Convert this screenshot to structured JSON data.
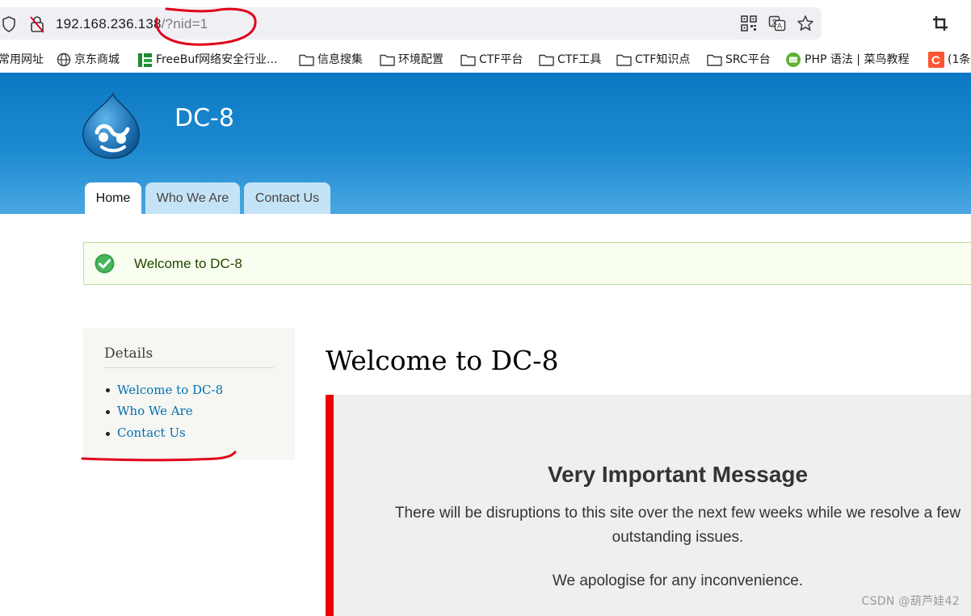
{
  "browser": {
    "url_host": "192.168.236.138",
    "url_path": "/?nid=1",
    "bookmarks": [
      {
        "label": "常用网址",
        "icon": "none"
      },
      {
        "label": "京东商城",
        "icon": "globe-icon"
      },
      {
        "label": "FreeBuf网络安全行业...",
        "icon": "freebuf-icon"
      },
      {
        "label": "信息搜集",
        "icon": "folder-icon"
      },
      {
        "label": "环境配置",
        "icon": "folder-icon"
      },
      {
        "label": "CTF平台",
        "icon": "folder-icon"
      },
      {
        "label": "CTF工具",
        "icon": "folder-icon"
      },
      {
        "label": "CTF知识点",
        "icon": "folder-icon"
      },
      {
        "label": "SRC平台",
        "icon": "folder-icon"
      },
      {
        "label": "PHP 语法 | 菜鸟教程",
        "icon": "runoob-icon"
      },
      {
        "label": "(1条",
        "icon": "csdn-icon"
      }
    ]
  },
  "site": {
    "name": "DC-8",
    "tabs": [
      {
        "label": "Home",
        "active": true
      },
      {
        "label": "Who We Are",
        "active": false
      },
      {
        "label": "Contact Us",
        "active": false
      }
    ],
    "status_message": "Welcome to DC-8"
  },
  "sidebar": {
    "title": "Details",
    "links": [
      "Welcome to DC-8",
      "Who We Are",
      "Contact Us"
    ]
  },
  "main": {
    "title": "Welcome to DC-8",
    "message_heading": "Very Important Message",
    "paragraph1_line1": "There will be disruptions to this site over the next few weeks while we resolve a few",
    "paragraph1_line2": "outstanding issues.",
    "paragraph2": "We apologise for any inconvenience."
  },
  "watermark": "CSDN @葫芦娃42",
  "colors": {
    "header_blue": "#0c78c3",
    "link_blue": "#0071b3",
    "annotation_red": "#e0001a",
    "message_border_red": "#ee0000"
  }
}
